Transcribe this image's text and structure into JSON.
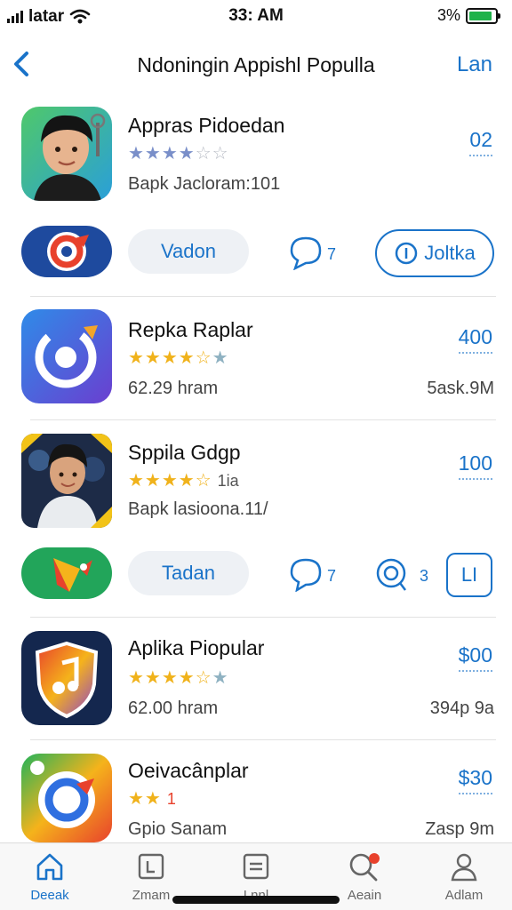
{
  "status_bar": {
    "carrier": "latar",
    "time": "33: AM",
    "battery": "3%",
    "battery_level": 0.9
  },
  "nav": {
    "back_icon": "chevron-left-icon",
    "title": "Ndoningin Appishl Populla",
    "right_action": "Lan"
  },
  "apps": [
    {
      "title": "Appras Pidoedan",
      "rating_filled": 4,
      "rating_color": "#7a8fc9",
      "price": "02",
      "meta": "Bapk Jacloram:101",
      "meta_right": ""
    },
    {
      "title": "Repka Raplar",
      "rating_filled": 4,
      "rating_color": "#f0b21b",
      "price": "400",
      "meta": "62.29 hram",
      "meta_right": "5ask.9M"
    },
    {
      "title": "Sppila Gdgp",
      "rating_filled": 4,
      "rating_color": "#f0b21b",
      "rating_extra": "1ia",
      "price": "100",
      "meta": "Bapk lasioona.11/",
      "meta_right": ""
    },
    {
      "title": "Aplika Piopular",
      "rating_filled": 4,
      "rating_color": "#f0b21b",
      "price": "$00",
      "meta": "62.00 hram",
      "meta_right": "394p 9a"
    },
    {
      "title": "Oeivacânplar",
      "rating_filled": 2,
      "rating_color": "#f0b21b",
      "rating_extra": "1",
      "price": "$30",
      "meta": "Gpio Sanam",
      "meta_right": "Zasp 9m"
    }
  ],
  "actions": [
    {
      "button_label": "Vadon",
      "comment_count": "7",
      "outline_label": "Joltka"
    },
    {
      "button_label": "Tadan",
      "comment_count": "7",
      "second_count": "3",
      "outline_label": "LI"
    }
  ],
  "tab_bar": {
    "tabs": [
      {
        "label": "Deeak",
        "icon": "home-icon",
        "active": true
      },
      {
        "label": "Zmam",
        "icon": "calendar-icon",
        "active": false
      },
      {
        "label": "Lnnl",
        "icon": "list-icon",
        "active": false
      },
      {
        "label": "Aeain",
        "icon": "search-icon",
        "active": false,
        "badge": true
      },
      {
        "label": "Adlam",
        "icon": "person-icon",
        "active": false
      }
    ]
  },
  "colors": {
    "accent": "#1a73c9",
    "star_gold": "#f0b21b",
    "star_blue": "#7a8fc9",
    "notification_red": "#e8412c"
  }
}
